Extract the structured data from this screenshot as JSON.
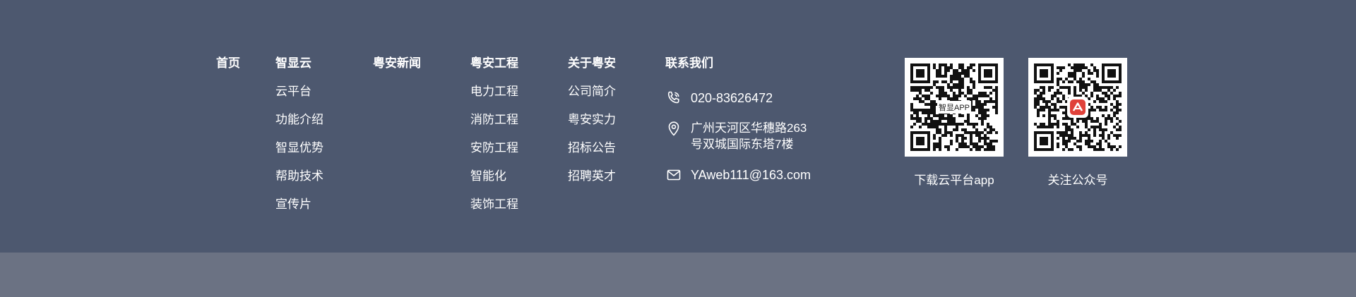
{
  "nav": {
    "home": "首页",
    "cloud": {
      "title": "智显云",
      "items": [
        "云平台",
        "功能介绍",
        "智显优势",
        "帮助技术",
        "宣传片"
      ]
    },
    "news": {
      "title": "粤安新闻"
    },
    "engineering": {
      "title": "粤安工程",
      "items": [
        "电力工程",
        "消防工程",
        "安防工程",
        "智能化",
        "装饰工程"
      ]
    },
    "about": {
      "title": "关于粤安",
      "items": [
        "公司简介",
        "粤安实力",
        "招标公告",
        "招聘英才"
      ]
    }
  },
  "contact": {
    "title": "联系我们",
    "phone": "020-83626472",
    "address_line1": "广州天河区华穗路263",
    "address_line2": "号双城国际东塔7楼",
    "email": "YAweb111@163.com",
    "icons": {
      "phone": "phone-icon",
      "address": "location-pin-icon",
      "email": "mail-icon"
    }
  },
  "qr_codes": [
    {
      "caption": "下载云平台app",
      "center_label": "智显APP"
    },
    {
      "caption": "关注公众号"
    }
  ],
  "colors": {
    "footer_bg": "#4d586f",
    "bottom_bar_bg": "#6b7283",
    "text": "#ffffff",
    "logo_red": "#e0413a"
  }
}
